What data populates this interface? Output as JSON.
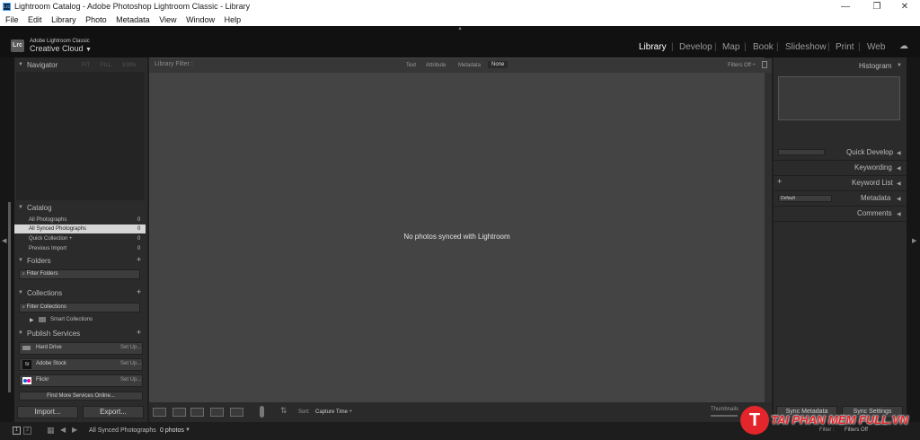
{
  "window": {
    "title": "Lightroom Catalog - Adobe Photoshop Lightroom Classic - Library",
    "app_icon": "Lrc"
  },
  "menu": [
    "File",
    "Edit",
    "Library",
    "Photo",
    "Metadata",
    "View",
    "Window",
    "Help"
  ],
  "identity": {
    "badge": "Lrc",
    "line1": "Adobe Lightroom Classic",
    "line2": "Creative Cloud",
    "dropdown_icon": "▼"
  },
  "modules": [
    "Library",
    "Develop",
    "Map",
    "Book",
    "Slideshow",
    "Print",
    "Web"
  ],
  "active_module": "Library",
  "navigator": {
    "title": "Navigator",
    "zoom": [
      "FIT",
      "FILL",
      "100%"
    ]
  },
  "catalog": {
    "title": "Catalog",
    "items": [
      {
        "label": "All Photographs",
        "count": "0"
      },
      {
        "label": "All Synced Photographs",
        "count": "0"
      },
      {
        "label": "Quick Collection +",
        "count": "0"
      },
      {
        "label": "Previous Import",
        "count": "0"
      }
    ]
  },
  "folders": {
    "title": "Folders",
    "filter_placeholder": "Filter Folders"
  },
  "collections": {
    "title": "Collections",
    "filter_placeholder": "Filter Collections",
    "smart": "Smart Collections"
  },
  "publish": {
    "title": "Publish Services",
    "services": [
      {
        "name": "Hard Drive",
        "action": "Set Up..."
      },
      {
        "name": "Adobe Stock",
        "action": "Set Up..."
      },
      {
        "name": "Flickr",
        "action": "Set Up..."
      }
    ],
    "find_more": "Find More Services Online..."
  },
  "left_buttons": {
    "import": "Import...",
    "export": "Export..."
  },
  "filter_bar": {
    "title": "Library Filter :",
    "tabs": [
      "Text",
      "Attribute",
      "Metadata",
      "None"
    ],
    "active_tab": "None",
    "status": "Filters Off ÷"
  },
  "center": {
    "message": "No photos synced with Lightroom"
  },
  "toolbar": {
    "sort_label": "Sort:",
    "sort_value": "Capture Time ÷",
    "thumbnails": "Thumbnails"
  },
  "right": {
    "histogram": "Histogram",
    "panels": [
      "Quick Develop",
      "Keywording",
      "Keyword List",
      "Metadata",
      "Comments"
    ],
    "metadata_preset": "Default",
    "sync_metadata": "Sync Metadata",
    "sync_settings": "Sync Settings"
  },
  "filmstrip": {
    "pages": [
      "1",
      "2"
    ],
    "source": "All Synced Photographs",
    "count": "0 photos",
    "filter_label": "Filter :",
    "filter_value": "Filters Off"
  },
  "watermark": {
    "text": "TAI PHAN MEM FULL.VN",
    "accent": "#e3262b"
  },
  "colors": {
    "accent": "#ffffff",
    "panel": "#2b2b2b",
    "center": "#444444"
  }
}
